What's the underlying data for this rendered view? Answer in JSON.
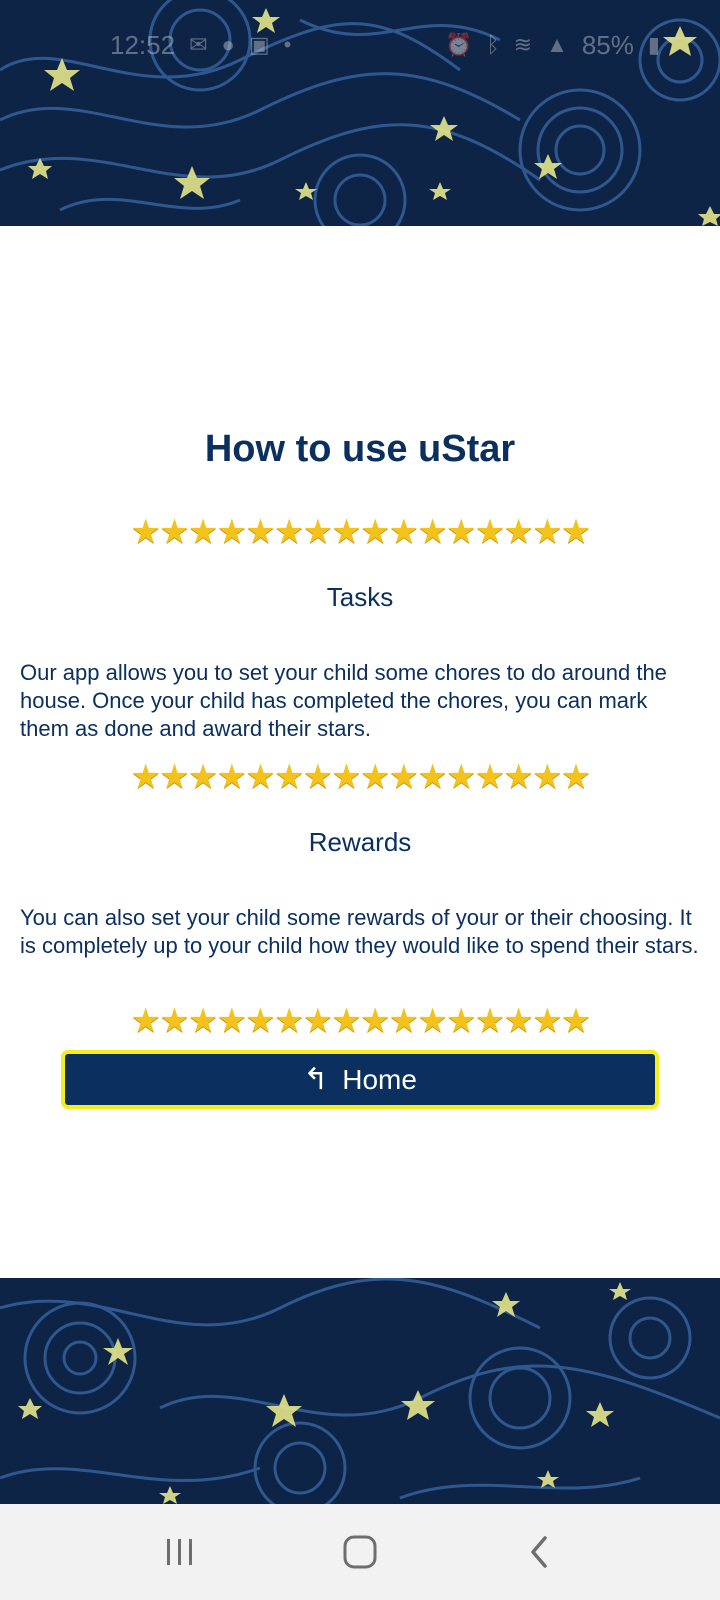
{
  "status_bar": {
    "time": "12:52",
    "battery": "85%"
  },
  "page": {
    "title": "How to use uStar",
    "stars": "★★★★★★★★★★★★★★★★",
    "sections": [
      {
        "heading": "Tasks",
        "text": "Our app allows you to set your child some chores to do around the house. Once your child has completed the chores, you can mark them as done and award their stars."
      },
      {
        "heading": "Rewards",
        "text": "You can also set your child some rewards of your or their choosing. It is completely up to your child how they would like to spend their stars."
      }
    ],
    "home_button": {
      "arrow": "↰",
      "label": "Home"
    }
  },
  "nav_bar": {
    "icons": [
      "recent-apps-icon",
      "home-icon",
      "back-icon"
    ]
  },
  "colors": {
    "primary": "#0b3060",
    "button_border": "#f4ef19",
    "star": "#f3c21b",
    "banner_bg": "#0d2447",
    "nav_bg": "#f2f2f2"
  }
}
